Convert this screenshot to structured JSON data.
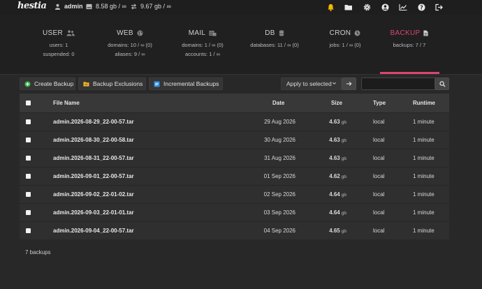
{
  "brand": {
    "logo_text": "hestia"
  },
  "topbar": {
    "user": "admin",
    "disk": "8.58 gb / ∞",
    "bandwidth": "9.67 gb / ∞",
    "icons": [
      "bell-icon",
      "folder-icon",
      "gear-icon",
      "user-circle-icon",
      "chart-icon",
      "help-icon",
      "logout-icon"
    ],
    "bell_color": "#f5b800"
  },
  "stats": [
    {
      "title": "USER",
      "icon": "users-icon",
      "lines": [
        "users: 1",
        "suspended: 0"
      ]
    },
    {
      "title": "WEB",
      "icon": "globe-icon",
      "lines": [
        "domains: 10 / ∞ (0)",
        "aliases: 9 / ∞"
      ]
    },
    {
      "title": "MAIL",
      "icon": "mail-icon",
      "lines": [
        "domains: 1 / ∞ (0)",
        "accounts: 1 / ∞"
      ]
    },
    {
      "title": "DB",
      "icon": "database-icon",
      "lines": [
        "databases: 11 / ∞ (0)"
      ]
    },
    {
      "title": "CRON",
      "icon": "clock-icon",
      "lines": [
        "jobs: 1 / ∞ (0)"
      ]
    },
    {
      "title": "BACKUP",
      "icon": "file-icon",
      "lines": [
        "backups: 7 / 7"
      ],
      "active": true
    }
  ],
  "accent_color": "#d9466f",
  "toolbar": {
    "create_backup": "Create Backup",
    "backup_exclusions": "Backup Exclusions",
    "incremental_backups": "Incremental Backups",
    "bulk_action": "Apply to selected",
    "search_value": ""
  },
  "table": {
    "headers": {
      "name": "File Name",
      "date": "Date",
      "size": "Size",
      "type": "Type",
      "runtime": "Runtime"
    },
    "rows": [
      {
        "name": "admin.2026-08-29_22-00-57.tar",
        "date": "29 Aug 2026",
        "size": "4.63",
        "unit": "gb",
        "type": "local",
        "runtime": "1 minute"
      },
      {
        "name": "admin.2026-08-30_22-00-58.tar",
        "date": "30 Aug 2026",
        "size": "4.63",
        "unit": "gb",
        "type": "local",
        "runtime": "1 minute"
      },
      {
        "name": "admin.2026-08-31_22-00-57.tar",
        "date": "31 Aug 2026",
        "size": "4.63",
        "unit": "gb",
        "type": "local",
        "runtime": "1 minute"
      },
      {
        "name": "admin.2026-09-01_22-00-57.tar",
        "date": "01 Sep 2026",
        "size": "4.62",
        "unit": "gb",
        "type": "local",
        "runtime": "1 minute"
      },
      {
        "name": "admin.2026-09-02_22-01-02.tar",
        "date": "02 Sep 2026",
        "size": "4.64",
        "unit": "gb",
        "type": "local",
        "runtime": "1 minute"
      },
      {
        "name": "admin.2026-09-03_22-01-01.tar",
        "date": "03 Sep 2026",
        "size": "4.64",
        "unit": "gb",
        "type": "local",
        "runtime": "1 minute"
      },
      {
        "name": "admin.2026-09-04_22-00-57.tar",
        "date": "04 Sep 2026",
        "size": "4.65",
        "unit": "gb",
        "type": "local",
        "runtime": "1 minute"
      }
    ]
  },
  "footer": {
    "count": "7 backups"
  }
}
